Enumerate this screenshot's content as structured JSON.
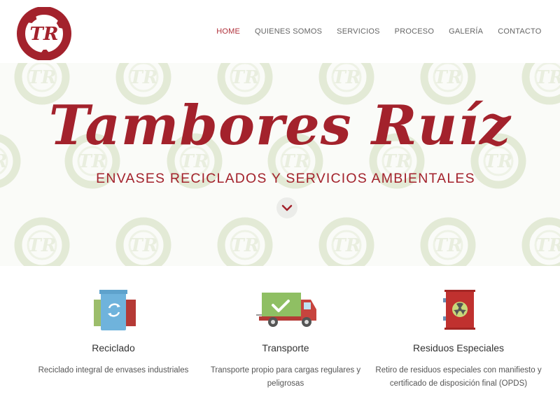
{
  "brand": {
    "logo_name": "tambores-ruiz-logo",
    "logo_monogram": "TR"
  },
  "nav": [
    {
      "label": "HOME",
      "active": true
    },
    {
      "label": "QUIENES SOMOS",
      "active": false
    },
    {
      "label": "SERVICIOS",
      "active": false
    },
    {
      "label": "PROCESO",
      "active": false
    },
    {
      "label": "GALERÍA",
      "active": false
    },
    {
      "label": "CONTACTO",
      "active": false
    }
  ],
  "hero": {
    "title": "Tambores Ruíz",
    "subtitle": "ENVASES RECICLADOS Y SERVICIOS AMBIENTALES",
    "scroll_icon": "chevron-down-icon"
  },
  "services": [
    {
      "icon": "recycling-bins-icon",
      "title": "Reciclado",
      "description": "Reciclado integral de envases industriales"
    },
    {
      "icon": "delivery-truck-icon",
      "title": "Transporte",
      "description": "Transporte propio para cargas regulares y peligrosas"
    },
    {
      "icon": "hazard-barrel-icon",
      "title": "Residuos Especiales",
      "description": "Retiro de residuos especiales con manifiesto y certificado de disposición final (OPDS)"
    }
  ],
  "colors": {
    "brand": "#a3222c",
    "nav_active": "#b0303a",
    "pattern": "#e3ead6"
  }
}
